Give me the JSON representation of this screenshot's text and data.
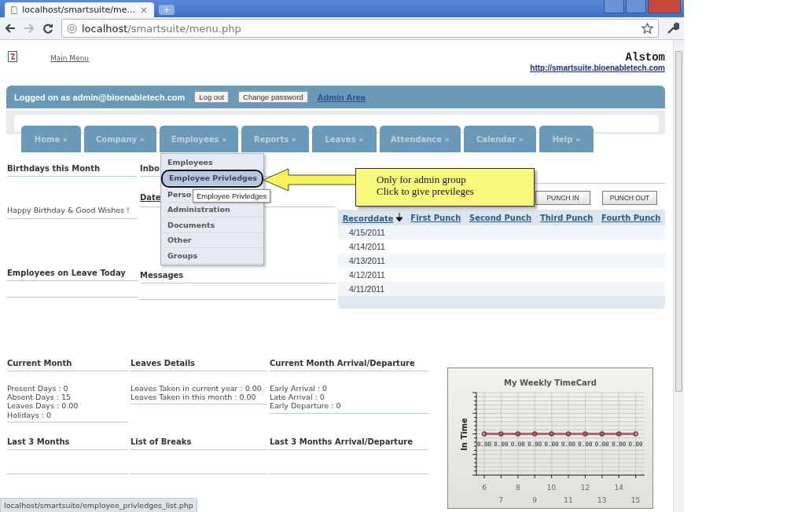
{
  "browser": {
    "tab_title": "localhost/smartsuite/me...",
    "tab_close": "×",
    "new_tab": "+",
    "address_host": "localhost",
    "address_path": "/smartsuite/menu.php"
  },
  "header": {
    "main_menu_link": "Main Menu",
    "company": "Alstom",
    "company_url": "http://smartsuite.bioenabletech.com"
  },
  "login_bar": {
    "text": "Logged on as admin@bioenabletech.com",
    "buttons": [
      "Log out",
      "Change password"
    ],
    "admin_link": "Admin Area"
  },
  "nav": [
    {
      "label": "Home »"
    },
    {
      "label": "Company »"
    },
    {
      "label": "Employees »"
    },
    {
      "label": "Reports »"
    },
    {
      "label": "Leaves »"
    },
    {
      "label": "Attendance »"
    },
    {
      "label": "Calendar »"
    },
    {
      "label": "Help »"
    }
  ],
  "left_panels": [
    {
      "heading": "Birthdays this Month",
      "text": "Happy Birthday & Good Wishes !"
    },
    {
      "heading": "Employees on Leave Today"
    }
  ],
  "middle_panels": [
    {
      "heading": "Inbo",
      "column": "Date"
    },
    {
      "heading": "Messages"
    }
  ],
  "attendance": {
    "buttons": [
      "PUNCH IN",
      "PUNCH OUT"
    ],
    "columns": [
      {
        "label": "Recorddate",
        "sorted": true
      },
      {
        "label": "First Punch",
        "sorted": false
      },
      {
        "label": "Second Punch",
        "sorted": false
      },
      {
        "label": "Third Punch",
        "sorted": false
      },
      {
        "label": "Fourth Punch",
        "sorted": false
      }
    ],
    "rows": [
      "4/15/2011",
      "4/14/2011",
      "4/13/2011",
      "4/12/2011",
      "4/11/2011"
    ]
  },
  "summary": [
    {
      "heading": "Current Month",
      "lines": [
        "Present Days : 0",
        "Absent Days : 15",
        "Leaves Days : 0.00",
        "Holidays : 0"
      ]
    },
    {
      "heading": "Leaves Details",
      "lines": [
        "Leaves Taken in current year : 0.00",
        "Leaves Taken in this month : 0.00"
      ]
    },
    {
      "heading": "Current Month Arrival/Departure",
      "lines": [
        "Early Arrival : 0",
        "Late Arrival : 0",
        "Early Departure : 0"
      ]
    },
    {
      "heading": "Last 3 Months"
    },
    {
      "heading": "List of Breaks"
    },
    {
      "heading": "Last 3 Months Arrival/Departure"
    }
  ],
  "timecard": {
    "title": "My Weekly TimeCard",
    "ylabel": "In Time",
    "x_labels": [
      "6",
      "7",
      "8",
      "9",
      "10",
      "11",
      "12",
      "13",
      "14",
      "15"
    ],
    "point_labels": [
      "0.00",
      "0.00",
      "0.00",
      "0.00",
      "0.00",
      "0.00",
      "0.00",
      "0.00",
      "0.00",
      "0.00"
    ]
  },
  "dropdown": {
    "items": [
      {
        "label": "Employees",
        "selected": false
      },
      {
        "label": "Employee Privledges",
        "selected": true
      },
      {
        "label": "Perso",
        "selected": false
      },
      {
        "label": "Administration",
        "selected": false
      },
      {
        "label": "Documents",
        "selected": false
      },
      {
        "label": "Other",
        "selected": false
      },
      {
        "label": "Groups",
        "selected": false
      }
    ]
  },
  "tooltip": "Employee Privledges",
  "callout": {
    "lines": [
      "Only for admin group",
      "Click to give previleges"
    ]
  },
  "status_bar": "localhost/smartsuite/employee_privledges_list.php"
}
